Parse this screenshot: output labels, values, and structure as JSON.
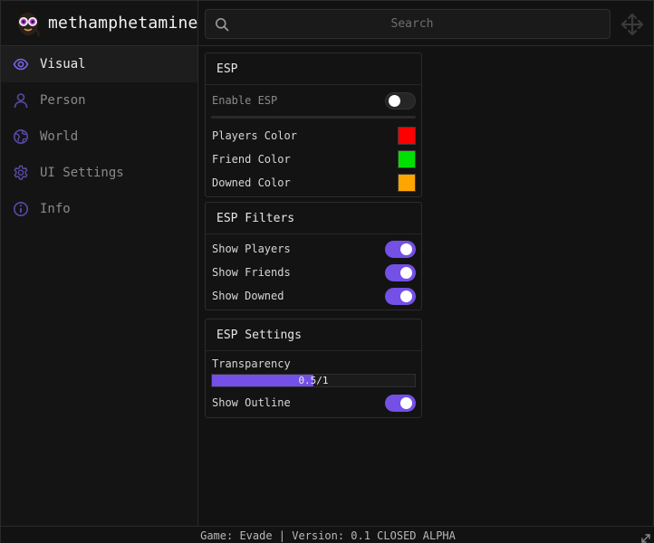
{
  "app": {
    "title": "methamphetamine",
    "logo_icon": "mascot-face-icon"
  },
  "header": {
    "search_placeholder": "Search",
    "search_value": "",
    "move_icon": "move-icon"
  },
  "sidebar": {
    "items": [
      {
        "label": "Visual",
        "icon": "eye-icon",
        "active": true
      },
      {
        "label": "Person",
        "icon": "person-icon",
        "active": false
      },
      {
        "label": "World",
        "icon": "globe-icon",
        "active": false
      },
      {
        "label": "UI Settings",
        "icon": "gear-icon",
        "active": false
      },
      {
        "label": "Info",
        "icon": "info-icon",
        "active": false
      }
    ]
  },
  "esp": {
    "title": "ESP",
    "enable_label": "Enable ESP",
    "enable_on": false,
    "players_color_label": "Players Color",
    "players_color": "#ff0000",
    "friend_color_label": "Friend Color",
    "friend_color": "#00e000",
    "downed_color_label": "Downed Color",
    "downed_color": "#ffa500"
  },
  "filters": {
    "title": "ESP Filters",
    "show_players_label": "Show Players",
    "show_players_on": true,
    "show_friends_label": "Show Friends",
    "show_friends_on": true,
    "show_downed_label": "Show Downed",
    "show_downed_on": true
  },
  "settings": {
    "title": "ESP Settings",
    "transparency_label": "Transparency",
    "transparency_value": 0.5,
    "transparency_max": 1,
    "transparency_text": "0.5/1",
    "show_outline_label": "Show Outline",
    "show_outline_on": true
  },
  "footer": {
    "text": "Game: Evade | Version: 0.1 CLOSED ALPHA"
  },
  "colors": {
    "accent": "#7450e6",
    "background": "#121212"
  }
}
